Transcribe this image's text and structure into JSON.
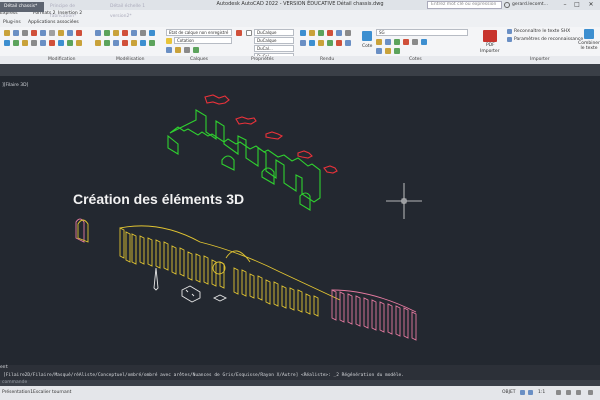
{
  "window": {
    "title": "Autodesk AutoCAD 2022 - VERSION ÉDUCATIVE    Détail chassis.dwg",
    "search_placeholder": "Entrez mot clé ou expression",
    "user": "gerard.lecomt..."
  },
  "menu_tabs_row1": [
    "Express",
    "Formats 2",
    "Insertion 2"
  ],
  "menu_tabs_row2": [
    "Plug-ins",
    "Applications associées"
  ],
  "ribbon": {
    "layer_state": "Etat de calque non enregistré",
    "layer_name": "Cotation",
    "prop_color": "DuCalque",
    "prop_linetype": "DuCalque",
    "prop_lineweight": "DuCal...",
    "prop_plot": "DuCal...",
    "dim_style": "SG",
    "cote_label": "Cote",
    "pdf_label": "PDF",
    "importer_label": "Importer",
    "shx_label": "Reconnaître le texte SHX",
    "recog_label": "Paramètres de reconnaissance",
    "combine_label": "Combiner le texte",
    "panels": [
      "Modification",
      "Modélisation",
      "Calques",
      "Propriétés",
      "Rendu",
      "Cotes",
      "Importer"
    ]
  },
  "view_tools": {
    "style": "Sans nom",
    "share": "Partager"
  },
  "doc_tabs": [
    {
      "label": "Détail chassis*",
      "active": true
    },
    {
      "label": "Principe de fabrication*",
      "active": false
    },
    {
      "label": "Détail échelle 1 version2*",
      "active": false
    }
  ],
  "viewport": {
    "label": "][Filaire 3D]",
    "heading": "Création des éléments 3D"
  },
  "command_line": {
    "line1": "ent",
    "line2": "[Filaire2D/Filaire/Masqué/réAliste/Conceptuel/ombré/ombré avec arêtes/Nuances de Gris/Esquisse/Rayon X/Autre] <Réaliste>: _2 Régénération du modèle.",
    "prompt": "commande"
  },
  "status_bar": {
    "tabs": [
      "Présentation1",
      "Escalier tournant"
    ],
    "objet": "OBJET",
    "scale": "1:1"
  },
  "colors": {
    "green": "#2fd12f",
    "red": "#e8323a",
    "yellow": "#e2c532",
    "pink": "#e57aa0",
    "canvas": "#232830"
  }
}
